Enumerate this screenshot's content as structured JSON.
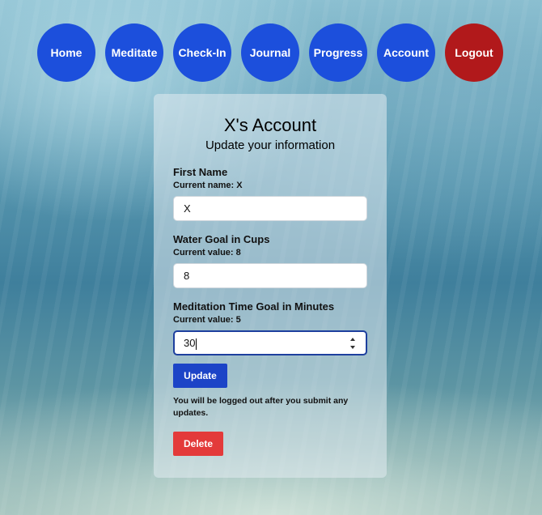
{
  "nav": {
    "items": [
      {
        "label": "Home"
      },
      {
        "label": "Meditate"
      },
      {
        "label": "Check-In"
      },
      {
        "label": "Journal"
      },
      {
        "label": "Progress"
      },
      {
        "label": "Account"
      }
    ],
    "logout_label": "Logout",
    "colors": {
      "primary": "#1c4fdc",
      "logout": "#b1191b"
    }
  },
  "account": {
    "title": "X's Account",
    "subtitle": "Update your information",
    "fields": [
      {
        "label": "First Name",
        "current": "Current name: X",
        "value": "X"
      },
      {
        "label": "Water Goal in Cups",
        "current": "Current value: 8",
        "value": "8"
      },
      {
        "label": "Meditation Time Goal in Minutes",
        "current": "Current value: 5",
        "value": "30"
      }
    ],
    "update_label": "Update",
    "note": "You will be logged out after you submit any updates.",
    "delete_label": "Delete",
    "colors": {
      "update": "#1c44c7",
      "delete": "#e33a3a"
    }
  }
}
